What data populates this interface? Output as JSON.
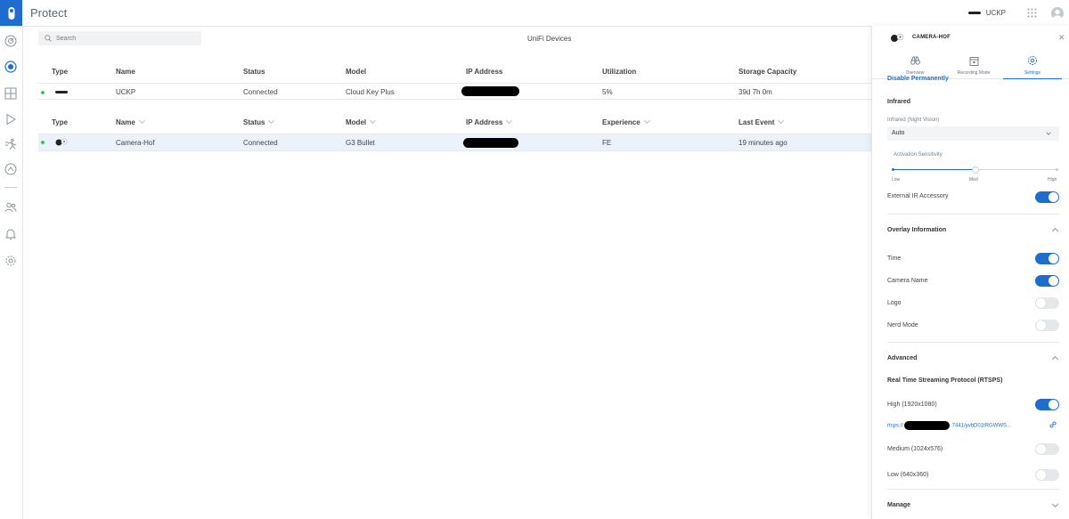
{
  "app": {
    "title": "Protect"
  },
  "topbar": {
    "device_name": "UCKP"
  },
  "search": {
    "placeholder": "Search"
  },
  "main": {
    "title": "UniFi Devices",
    "consoles_table": {
      "headers": [
        "Type",
        "Name",
        "Status",
        "Model",
        "IP Address",
        "Utilization",
        "Storage Capacity"
      ],
      "rows": [
        {
          "name": "UCKP",
          "status": "Connected",
          "model": "Cloud Key Plus",
          "utilization": "5%",
          "storage": "39d 7h 0m"
        }
      ]
    },
    "cameras_table": {
      "headers": [
        "Type",
        "Name",
        "Status",
        "Model",
        "IP Address",
        "Experience",
        "Last Event"
      ],
      "rows": [
        {
          "name": "Camera-Hof",
          "status": "Connected",
          "model": "G3 Bullet",
          "experience": "FE",
          "last_event": "19 minutes ago"
        }
      ]
    },
    "status_color": "#3ec165"
  },
  "panel": {
    "camera_name": "CAMERA-HOF",
    "tabs": [
      "Overview",
      "Recording Mode",
      "Settings"
    ],
    "active_tab": "Settings",
    "disable_link": "Disable Permanently",
    "infrared": {
      "heading": "Infrared",
      "mode_label": "Infrared (Night Vision)",
      "mode_value": "Auto",
      "sensitivity_label": "Activation Sensitivity",
      "sensitivity_levels": [
        "Low",
        "Med",
        "High"
      ],
      "sensitivity_value": "Med",
      "external_ir_label": "External IR Accessory",
      "external_ir": true
    },
    "overlay": {
      "heading": "Overlay Information",
      "items": [
        {
          "label": "Time",
          "on": true
        },
        {
          "label": "Camera Name",
          "on": true
        },
        {
          "label": "Logo",
          "on": false
        },
        {
          "label": "Nerd Mode",
          "on": false
        }
      ]
    },
    "advanced": {
      "heading": "Advanced",
      "rtsp_heading": "Real Time Streaming Protocol (RTSPS)",
      "streams": [
        {
          "label": "High (1920x1080)",
          "on": true
        },
        {
          "label": "Medium (1024x576)",
          "on": false
        },
        {
          "label": "Low (640x360)",
          "on": false
        }
      ],
      "rtsp_url_prefix": "rtsps://",
      "rtsp_url_suffix": ":7441/yvbD01tRGWWS..."
    },
    "manage": {
      "heading": "Manage"
    }
  },
  "colors": {
    "accent": "#1f6ccf",
    "toggle_off": "#e5e8eb"
  }
}
